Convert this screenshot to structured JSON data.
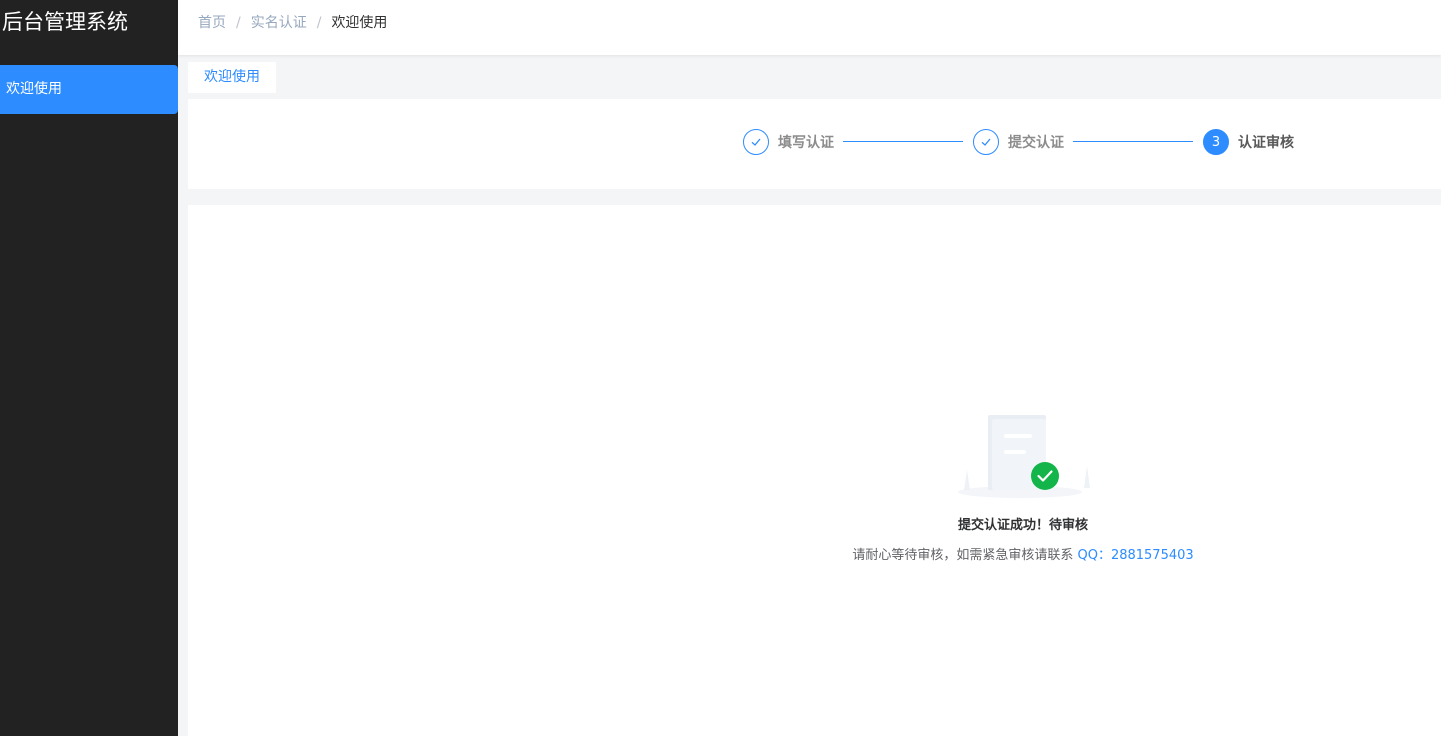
{
  "app": {
    "title": "后台管理系统"
  },
  "sidebar": {
    "items": [
      {
        "label": "欢迎使用"
      }
    ]
  },
  "breadcrumb": {
    "items": [
      "首页",
      "实名认证",
      "欢迎使用"
    ],
    "separator": "/"
  },
  "tabs": [
    {
      "label": "欢迎使用"
    }
  ],
  "steps": [
    {
      "title": "填写认证",
      "status": "finished",
      "icon": "check-icon"
    },
    {
      "title": "提交认证",
      "status": "finished",
      "icon": "check-icon"
    },
    {
      "title": "认证审核",
      "status": "active",
      "number": "3"
    }
  ],
  "result": {
    "icon": "document-success-icon",
    "title": "提交认证成功！待审核",
    "description": "请耐心等待审核，如需紧急审核请联系",
    "contact": "QQ：2881575403"
  },
  "colors": {
    "accent": "#2d8cff",
    "sidebar_bg": "#222222",
    "success": "#13b54a"
  }
}
